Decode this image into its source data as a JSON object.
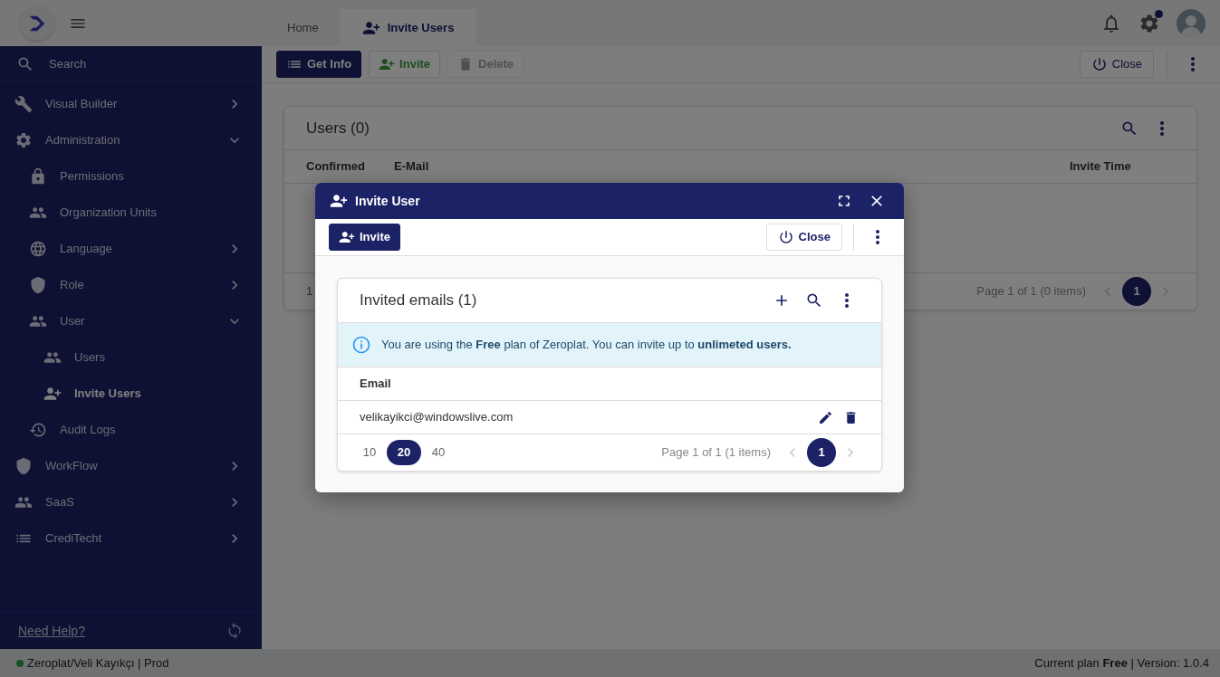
{
  "tabs": [
    {
      "label": "Home",
      "selected": false
    },
    {
      "label": "Invite Users",
      "selected": true
    }
  ],
  "header": {
    "settings_notification": true
  },
  "sidebar": {
    "search_label": "Search",
    "items": [
      {
        "label": "Visual Builder",
        "selected": false,
        "expanded": false
      },
      {
        "label": "Administration",
        "selected": false,
        "expanded": true,
        "children": [
          {
            "label": "Permissions",
            "selected": false
          },
          {
            "label": "Organization Units",
            "selected": false
          },
          {
            "label": "Language",
            "selected": false,
            "expanded": false
          },
          {
            "label": "Role",
            "selected": false,
            "expanded": false
          },
          {
            "label": "User",
            "selected": false,
            "expanded": true,
            "children": [
              {
                "label": "Users",
                "selected": false
              },
              {
                "label": "Invite Users",
                "selected": true
              }
            ]
          },
          {
            "label": "Audit Logs",
            "selected": false
          }
        ]
      },
      {
        "label": "WorkFlow",
        "selected": false,
        "expanded": false
      },
      {
        "label": "SaaS",
        "selected": false,
        "expanded": false
      },
      {
        "label": "CrediTecht",
        "selected": false,
        "expanded": false
      }
    ],
    "help_link": "Need Help?"
  },
  "toolbar": {
    "buttons": [
      {
        "label": "Get Info",
        "kind": "primary",
        "disabled": false
      },
      {
        "label": "Invite",
        "kind": "success",
        "disabled": false
      },
      {
        "label": "Delete",
        "kind": "delete",
        "disabled": true
      }
    ],
    "close_label": "Close"
  },
  "users_card": {
    "title": "Users (0)",
    "columns": [
      "Confirmed",
      "E-Mail",
      "Invite Time"
    ],
    "page_size_partial": "1",
    "page_info": "Page 1 of 1 (0 items)",
    "pages": [
      {
        "label": "1",
        "selected": true
      }
    ]
  },
  "modal": {
    "title": "Invite User",
    "invite_label": "Invite",
    "close_label": "Close",
    "card_title": "Invited emails (1)",
    "notice": "You are using the **Free** plan of Zeroplat. You can invite up to **unlimeted users.**",
    "columns": [
      "Email"
    ],
    "rows": [
      {
        "email": "velikayikci@windowslive.com"
      }
    ],
    "page_sizes": [
      {
        "label": "10",
        "selected": false
      },
      {
        "label": "20",
        "selected": true
      },
      {
        "label": "40",
        "selected": false
      }
    ],
    "page_info": "Page 1 of 1 (1 items)",
    "pages": [
      {
        "label": "1",
        "selected": true
      }
    ]
  },
  "status_bar": {
    "left": "Zeroplat/Veli Kayıkçı | Prod",
    "right": "Current plan **Free** | Version: 1.0.4"
  }
}
